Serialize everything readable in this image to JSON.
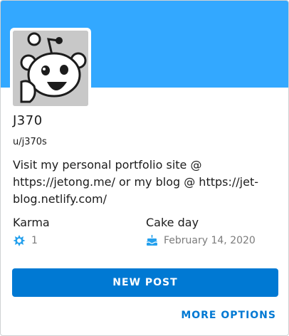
{
  "profile": {
    "display_name": "J370",
    "username": "u/j370s",
    "bio": "Visit my personal portfolio site @ https://jetong.me/ or my blog @ https://jet-blog.netlify.com/"
  },
  "stats": {
    "karma_label": "Karma",
    "karma_value": "1",
    "cakeday_label": "Cake day",
    "cakeday_value": "February 14, 2020"
  },
  "actions": {
    "new_post_label": "NEW POST",
    "more_options_label": "MORE OPTIONS"
  },
  "colors": {
    "banner": "#33a8ff",
    "primary": "#0079d3"
  },
  "icons": {
    "avatar": "snoo-avatar",
    "karma": "karma-icon",
    "cakeday": "cake-icon"
  }
}
